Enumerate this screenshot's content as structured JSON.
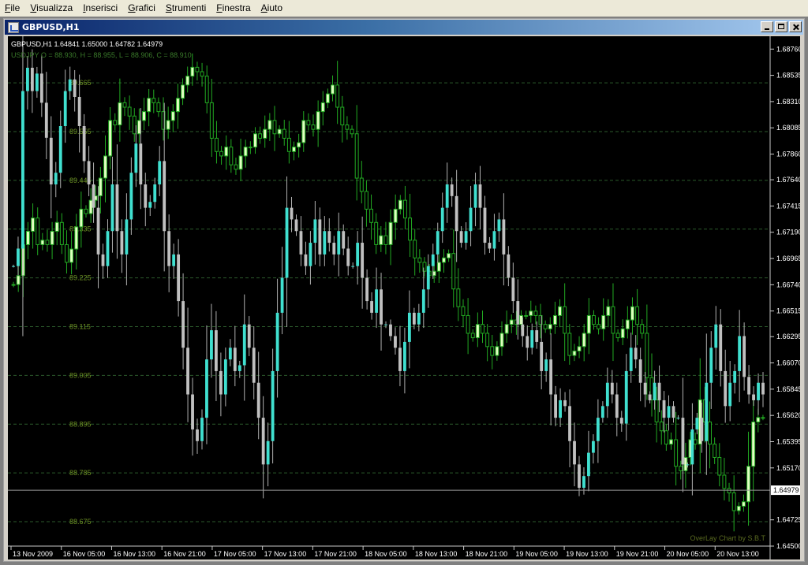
{
  "menu": [
    "File",
    "Visualizza",
    "Inserisci",
    "Grafici",
    "Strumenti",
    "Finestra",
    "Aiuto"
  ],
  "window": {
    "title": "GBPUSD,H1"
  },
  "chart_data": {
    "type": "candlestick",
    "symbol_line": "GBPUSD,H1  1.64841 1.65000 1.64782 1.64979",
    "overlay_line": "USDJPY O = 88.930, H = 88.955, L = 88.906, C = 88.910",
    "watermark": "OverLay Chart by S.B.T",
    "current_price": "1.64979",
    "current_price_value": 1.64979,
    "y_range": [
      1.645,
      1.6887
    ],
    "y_ticks": [
      "1.68760",
      "1.68535",
      "1.68310",
      "1.68085",
      "1.67860",
      "1.67640",
      "1.67415",
      "1.67190",
      "1.66965",
      "1.66740",
      "1.66515",
      "1.66295",
      "1.66070",
      "1.65845",
      "1.65620",
      "1.65395",
      "1.65170",
      "1.64725",
      "1.64500"
    ],
    "overlay_range": [
      88.62,
      89.77
    ],
    "overlay_levels": [
      "89.665",
      "89.555",
      "89.445",
      "89.335",
      "89.225",
      "89.115",
      "89.005",
      "88.895",
      "88.785",
      "88.675"
    ],
    "x_ticks": [
      "13 Nov 2009",
      "16 Nov 05:00",
      "16 Nov 13:00",
      "16 Nov 21:00",
      "17 Nov 05:00",
      "17 Nov 13:00",
      "17 Nov 21:00",
      "18 Nov 05:00",
      "18 Nov 13:00",
      "18 Nov 21:00",
      "19 Nov 05:00",
      "19 Nov 13:00",
      "19 Nov 21:00",
      "20 Nov 05:00",
      "20 Nov 13:00"
    ],
    "colors": {
      "bull": "#40e0d0",
      "bear": "#c0c0c0",
      "overlay_up": "#e0ffc0",
      "overlay": "#22aa22",
      "grid": "#2b5a2b",
      "label": "#6b8e23"
    },
    "gbpusd_close": [
      1.669,
      1.6705,
      1.684,
      1.686,
      1.684,
      1.6855,
      1.683,
      1.68,
      1.676,
      1.677,
      1.681,
      1.684,
      1.685,
      1.6835,
      1.681,
      1.678,
      1.676,
      1.674,
      1.67,
      1.669,
      1.672,
      1.676,
      1.672,
      1.67,
      1.673,
      1.677,
      1.6795,
      1.676,
      1.674,
      1.6745,
      1.676,
      1.678,
      1.672,
      1.669,
      1.67,
      1.666,
      1.662,
      1.658,
      1.655,
      1.654,
      1.656,
      1.661,
      1.6635,
      1.66,
      1.658,
      1.661,
      1.662,
      1.66,
      1.6605,
      1.664,
      1.662,
      1.659,
      1.656,
      1.652,
      1.654,
      1.66,
      1.665,
      1.668,
      1.674,
      1.673,
      1.672,
      1.67,
      1.669,
      1.671,
      1.673,
      1.67,
      1.672,
      1.671,
      1.67,
      1.672,
      1.6705,
      1.669,
      1.669,
      1.671,
      1.668,
      1.666,
      1.665,
      1.667,
      1.664,
      1.664,
      1.663,
      1.662,
      1.66,
      1.6625,
      1.665,
      1.664,
      1.665,
      1.667,
      1.669,
      1.67,
      1.672,
      1.674,
      1.676,
      1.675,
      1.672,
      1.671,
      1.672,
      1.674,
      1.676,
      1.674,
      1.671,
      1.6705,
      1.672,
      1.673,
      1.67,
      1.668,
      1.666,
      1.664,
      1.663,
      1.662,
      1.6635,
      1.6625,
      1.66,
      1.661,
      1.658,
      1.656,
      1.6575,
      1.657,
      1.654,
      1.652,
      1.65,
      1.651,
      1.653,
      1.654,
      1.656,
      1.657,
      1.659,
      1.658,
      1.656,
      1.6555,
      1.66,
      1.662,
      1.661,
      1.659,
      1.658,
      1.6575,
      1.659,
      1.6575,
      1.656,
      1.657,
      1.656,
      1.656,
      1.652,
      1.652,
      1.655,
      1.656,
      1.654,
      1.659,
      1.662,
      1.664,
      1.66,
      1.657,
      1.659,
      1.66,
      1.663,
      1.6595,
      1.658,
      1.6575,
      1.659,
      1.658
    ],
    "usdjpy_close": [
      89.21,
      89.23,
      89.3,
      89.33,
      89.36,
      89.3,
      89.31,
      89.3,
      89.33,
      89.35,
      89.3,
      89.26,
      89.29,
      89.34,
      89.38,
      89.37,
      89.4,
      89.41,
      89.45,
      89.5,
      89.58,
      89.57,
      89.62,
      89.61,
      89.59,
      89.55,
      89.58,
      89.6,
      89.63,
      89.62,
      89.6,
      89.56,
      89.58,
      89.6,
      89.63,
      89.66,
      89.68,
      89.7,
      89.69,
      89.68,
      89.62,
      89.54,
      89.51,
      89.5,
      89.52,
      89.48,
      89.47,
      89.5,
      89.52,
      89.52,
      89.55,
      89.54,
      89.56,
      89.58,
      89.55,
      89.56,
      89.54,
      89.51,
      89.52,
      89.53,
      89.58,
      89.57,
      89.56,
      89.6,
      89.62,
      89.64,
      89.66,
      89.61,
      89.57,
      89.56,
      89.55,
      89.45,
      89.42,
      89.38,
      89.35,
      89.3,
      89.32,
      89.3,
      89.35,
      89.38,
      89.4,
      89.36,
      89.31,
      89.27,
      89.26,
      89.24,
      89.23,
      89.24,
      89.26,
      89.27,
      89.28,
      89.2,
      89.16,
      89.14,
      89.1,
      89.09,
      89.12,
      89.1,
      89.07,
      89.05,
      89.07,
      89.1,
      89.12,
      89.13,
      89.12,
      89.14,
      89.14,
      89.15,
      89.14,
      89.12,
      89.11,
      89.12,
      89.14,
      89.16,
      89.1,
      89.05,
      89.06,
      89.07,
      89.1,
      89.14,
      89.12,
      89.11,
      89.14,
      89.16,
      89.1,
      89.09,
      89.11,
      89.13,
      89.16,
      89.12,
      89.1,
      89.0,
      88.95,
      88.9,
      88.88,
      88.85,
      88.86,
      88.8,
      88.79,
      88.82,
      88.86,
      88.85,
      88.95,
      88.9,
      88.85,
      88.82,
      88.78,
      88.75,
      88.74,
      88.7,
      88.71,
      88.72,
      88.8,
      88.9,
      88.91,
      88.91
    ]
  }
}
